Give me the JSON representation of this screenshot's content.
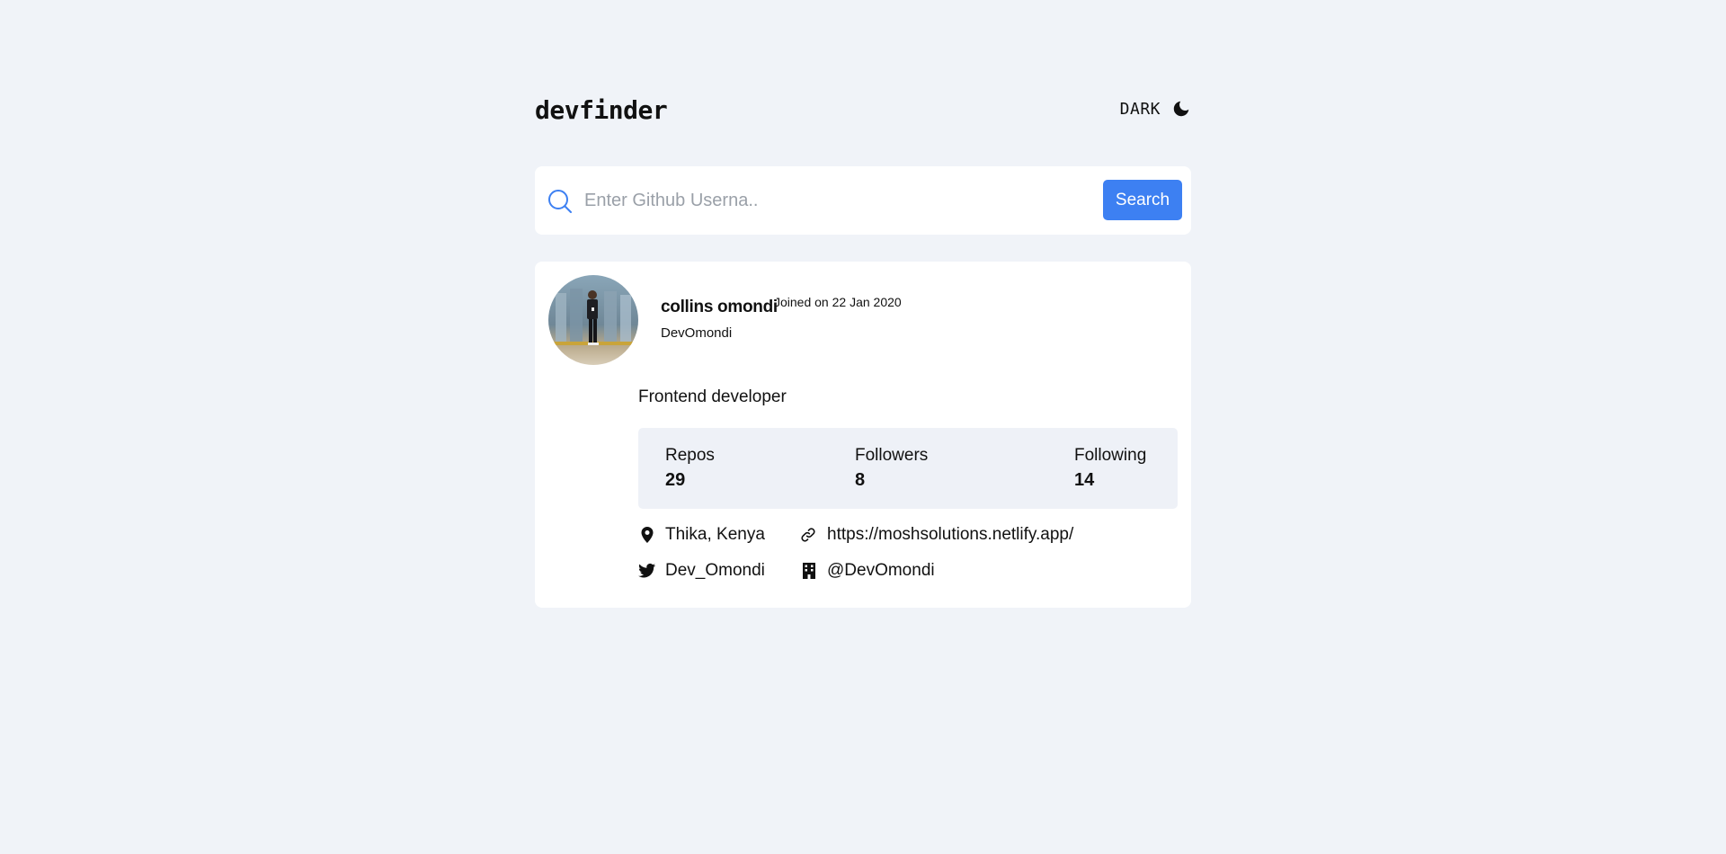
{
  "header": {
    "logo": "devfinder",
    "theme_label": "DARK",
    "theme_icon": "moon-icon"
  },
  "search": {
    "icon": "search-icon",
    "placeholder": "Enter Github Userna..",
    "value": "",
    "button_label": "Search"
  },
  "profile": {
    "name": "collins omondi",
    "joined": "Joined on 22 Jan 2020",
    "login": "DevOmondi",
    "bio": "Frontend developer",
    "stats": {
      "repos_label": "Repos",
      "repos_value": "29",
      "followers_label": "Followers",
      "followers_value": "8",
      "following_label": "Following",
      "following_value": "14"
    },
    "links": {
      "location": "Thika, Kenya",
      "blog": "https://moshsolutions.netlify.app/",
      "twitter": "Dev_Omondi",
      "company": "@DevOmondi"
    }
  },
  "colors": {
    "background": "#f0f3f8",
    "accent": "#3d80f2",
    "card": "#ffffff",
    "stats_bg": "#eef1f7"
  }
}
